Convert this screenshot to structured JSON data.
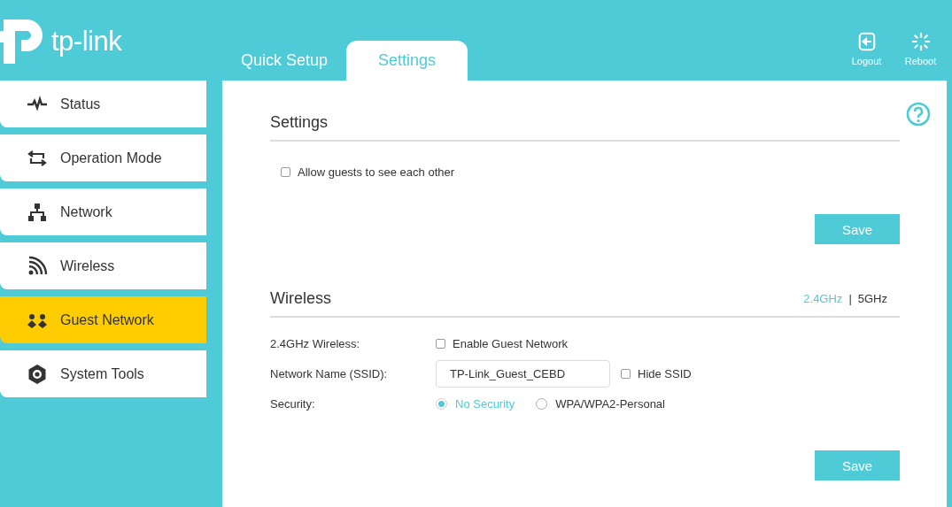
{
  "header": {
    "logo_text": "tp-link",
    "tabs": [
      {
        "label": "Quick Setup",
        "selected": false
      },
      {
        "label": "Settings",
        "selected": true
      }
    ],
    "actions": [
      {
        "kind": "logout",
        "label": "Logout"
      },
      {
        "kind": "reboot",
        "label": "Reboot"
      }
    ]
  },
  "sidebar": {
    "items": [
      {
        "kind": "status",
        "label": "Status",
        "selected": false
      },
      {
        "kind": "mode",
        "label": "Operation Mode",
        "selected": false
      },
      {
        "kind": "network",
        "label": "Network",
        "selected": false
      },
      {
        "kind": "wireless",
        "label": "Wireless",
        "selected": false
      },
      {
        "kind": "guest",
        "label": "Guest Network",
        "selected": true
      },
      {
        "kind": "tools",
        "label": "System Tools",
        "selected": false
      }
    ]
  },
  "settings_section": {
    "title": "Settings",
    "options": [
      {
        "label": "Allow guests to see each other",
        "checked": false
      }
    ],
    "save_button": "Save"
  },
  "wireless_section": {
    "title": "Wireless",
    "bands": [
      {
        "label": "2.4GHz",
        "selected": true
      },
      {
        "label": "5GHz",
        "selected": false
      }
    ],
    "band_separator": "|",
    "wireless_row": {
      "label": "2.4GHz Wireless:",
      "checkbox": {
        "label": "Enable Guest Network",
        "checked": false
      }
    },
    "ssid_row": {
      "label": "Network Name (SSID):",
      "value": "TP-Link_Guest_CEBD",
      "checkbox": {
        "label": "Hide SSID",
        "checked": false
      }
    },
    "security_row": {
      "label": "Security:",
      "options": [
        {
          "label": "No Security",
          "selected": true
        },
        {
          "label": "WPA/WPA2-Personal",
          "selected": false
        }
      ]
    },
    "save_button": "Save"
  }
}
